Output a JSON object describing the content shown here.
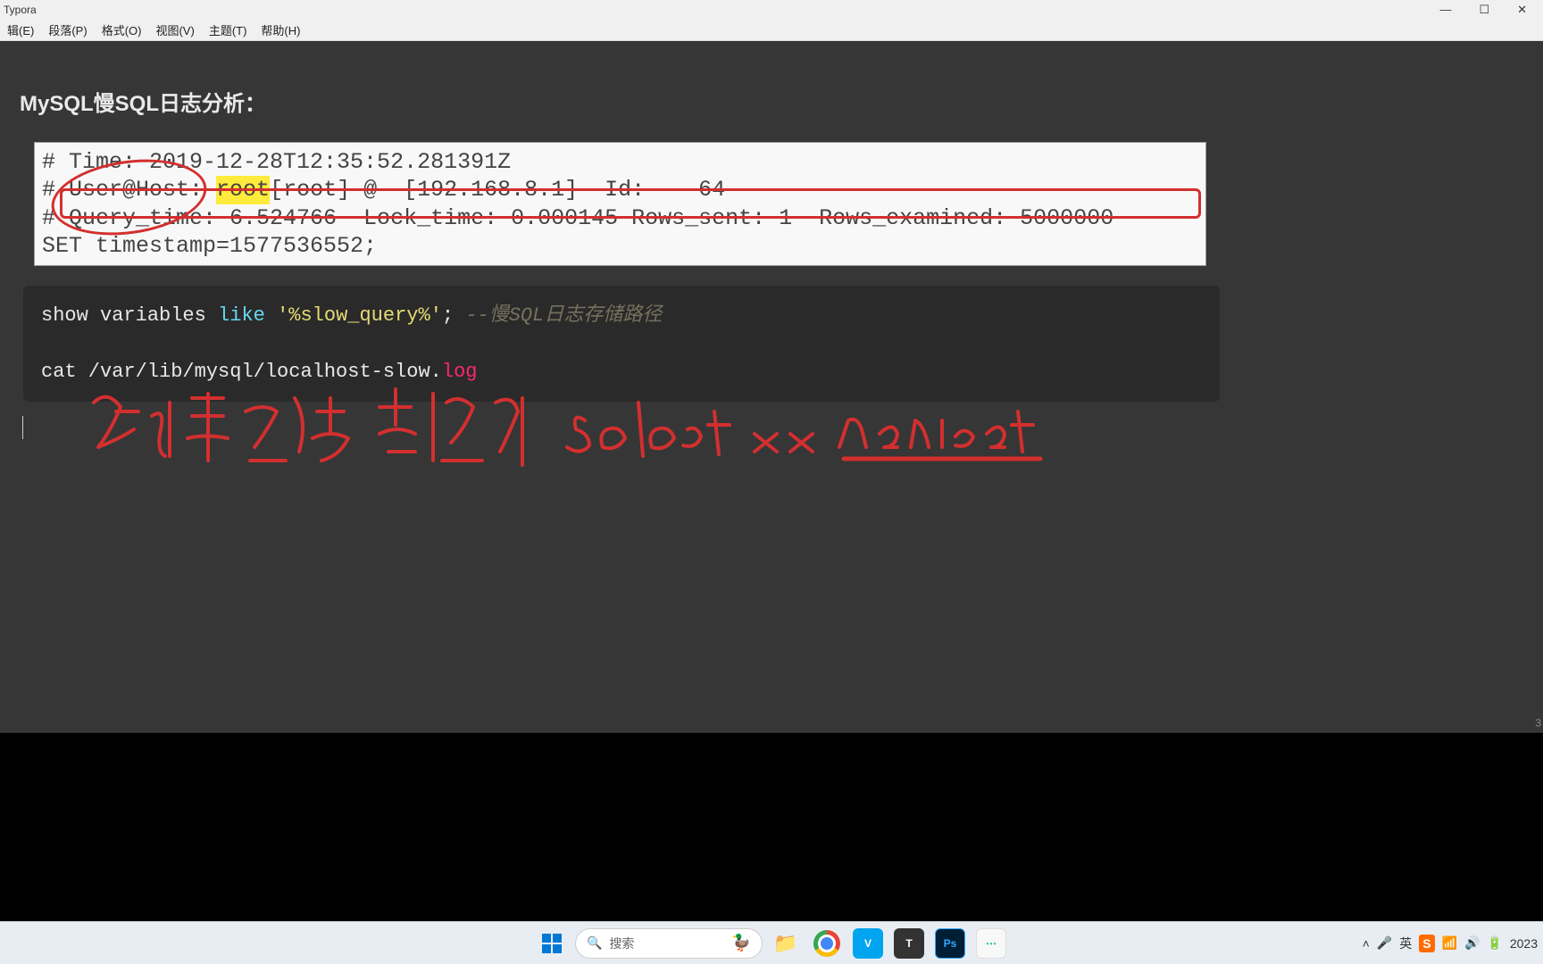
{
  "window": {
    "title": "Typora"
  },
  "menu": {
    "edit": "辑(E)",
    "paragraph": "段落(P)",
    "format": "格式(O)",
    "view": "视图(V)",
    "theme": "主题(T)",
    "help": "帮助(H)"
  },
  "doc": {
    "title": "MySQL慢SQL日志分析：",
    "log": {
      "line1": "# Time: 2019-12-28T12:35:52.281391Z",
      "line2a": "# User@Host: ",
      "line2_highlight": "root",
      "line2b": "[root] @  [192.168.8.1]  Id:    64",
      "line3": "# Query_time: 6.524766  Lock_time: 0.000145 Rows_sent: 1  Rows_examined: 5000000",
      "line4": "SET timestamp=1577536552;"
    },
    "code": {
      "line1_a": "show variables ",
      "line1_kw": "like",
      "line1_b": " ",
      "line1_str": "'%slow_query%'",
      "line1_c": ";  ",
      "line1_comment": "--慢SQL日志存储路径",
      "line2_a": "cat /var/lib/mysql/localhost-slow.",
      "line2_ext": "log"
    },
    "handwriting_words": [
      "查询时间",
      "指向",
      "select xx",
      "navicat"
    ],
    "word_count": "3"
  },
  "taskbar": {
    "search_placeholder": "搜索",
    "tray": {
      "ime_lang": "英",
      "time_suffix": "2023"
    }
  }
}
